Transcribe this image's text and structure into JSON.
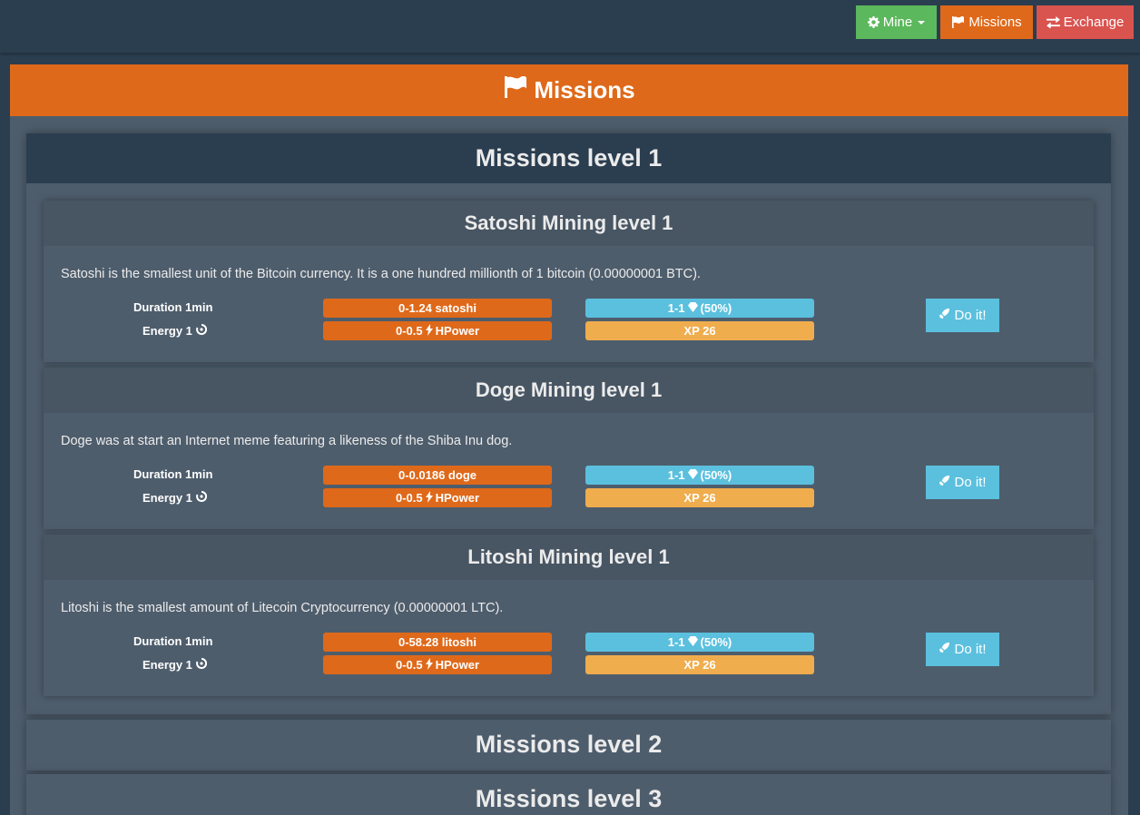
{
  "nav": {
    "mine_label": "Mine",
    "missions_label": "Missions",
    "exchange_label": "Exchange"
  },
  "panel": {
    "title": "Missions"
  },
  "levels": [
    {
      "title": "Missions level 1"
    },
    {
      "title": "Missions level 2"
    },
    {
      "title": "Missions level 3"
    }
  ],
  "missions": [
    {
      "title": "Satoshi Mining level 1",
      "description": "Satoshi is the smallest unit of the Bitcoin currency. It is a one hundred millionth of 1 bitcoin (0.00000001 BTC).",
      "duration": "Duration 1min",
      "energy": "Energy 1",
      "reward": "0-1.24 satoshi",
      "power": "0-0.5",
      "power_unit": "HPower",
      "chance": "1-1",
      "chance_pct": "(50%)",
      "xp": "XP 26",
      "button": "Do it!"
    },
    {
      "title": "Doge Mining level 1",
      "description": "Doge was at start an Internet meme featuring a likeness of the Shiba Inu dog.",
      "duration": "Duration 1min",
      "energy": "Energy 1",
      "reward": "0-0.0186 doge",
      "power": "0-0.5",
      "power_unit": "HPower",
      "chance": "1-1",
      "chance_pct": "(50%)",
      "xp": "XP 26",
      "button": "Do it!"
    },
    {
      "title": "Litoshi Mining level 1",
      "description": "Litoshi is the smallest amount of Litecoin Cryptocurrency (0.00000001 LTC).",
      "duration": "Duration 1min",
      "energy": "Energy 1",
      "reward": "0-58.28 litoshi",
      "power": "0-0.5",
      "power_unit": "HPower",
      "chance": "1-1",
      "chance_pct": "(50%)",
      "xp": "XP 26",
      "button": "Do it!"
    }
  ],
  "colors": {
    "background": "#2b3e50",
    "panel": "#4e5d6c",
    "primary": "#df691a",
    "success": "#5cb85c",
    "danger": "#d9534f",
    "info": "#5bc0de",
    "warning": "#f0ad4e"
  },
  "icons": {
    "mine": "gear-icon",
    "missions": "flag-icon",
    "exchange": "exchange-arrows-icon",
    "energy": "swirl-icon",
    "power": "bolt-icon",
    "chance": "gem-icon",
    "do_it": "rocket-icon"
  }
}
